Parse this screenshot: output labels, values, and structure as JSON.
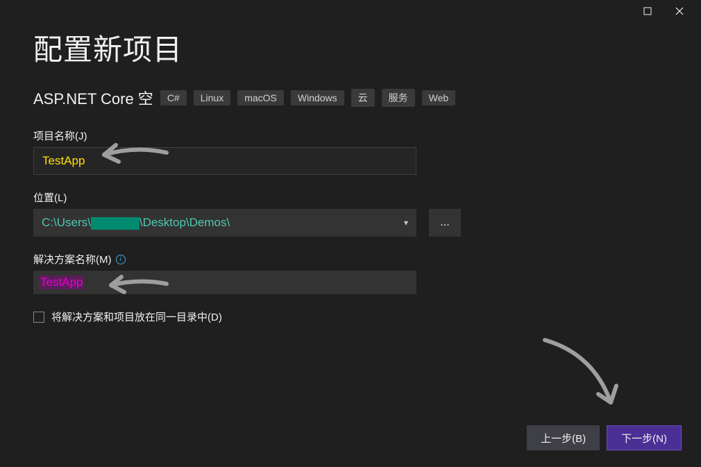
{
  "page": {
    "title": "配置新项目",
    "template_name": "ASP.NET Core 空",
    "tags": [
      "C#",
      "Linux",
      "macOS",
      "Windows",
      "云",
      "服务",
      "Web"
    ]
  },
  "form": {
    "project_name": {
      "label": "项目名称(J)",
      "value": "TestApp"
    },
    "location": {
      "label": "位置(L)",
      "prefix": "C:\\Users\\",
      "suffix": "\\Desktop\\Demos\\",
      "browse": "..."
    },
    "solution_name": {
      "label": "解决方案名称(M)",
      "value": "TestApp"
    },
    "same_dir": {
      "label": "将解决方案和项目放在同一目录中(D)",
      "checked": false
    }
  },
  "footer": {
    "back": "上一步(B)",
    "next": "下一步(N)"
  },
  "info_icon": "i"
}
